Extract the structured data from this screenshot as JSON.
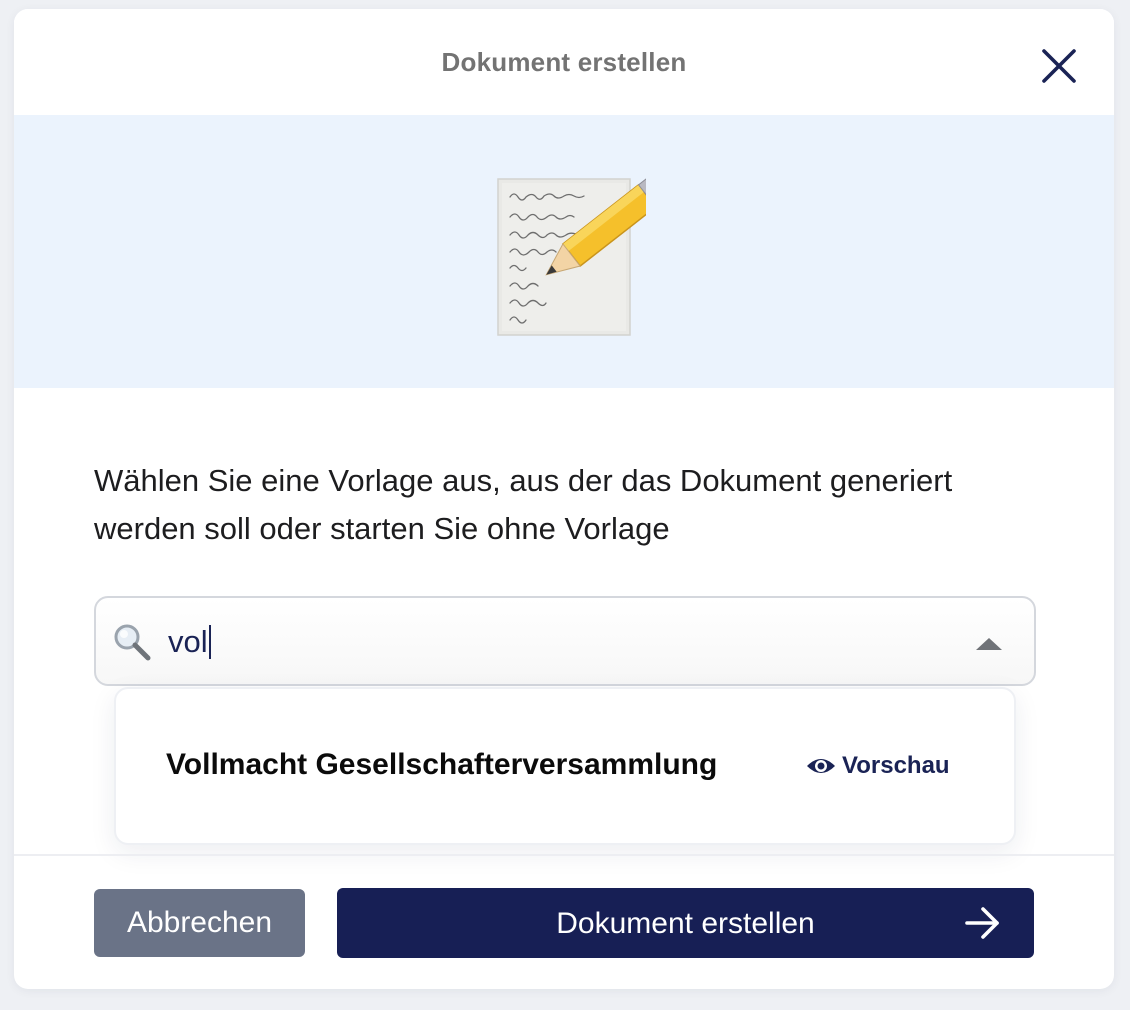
{
  "dialog": {
    "title": "Dokument erstellen",
    "close_icon": "close-icon"
  },
  "hero": {
    "icon": "memo-pencil-icon"
  },
  "instructions": "Wählen Sie eine Vorlage aus, aus der das Dokument generiert werden soll oder starten Sie ohne Vorlage",
  "search": {
    "value": "vol",
    "icon": "search-icon",
    "toggle_icon": "chevron-up-icon"
  },
  "dropdown": {
    "options": [
      {
        "label": "Vollmacht Gesellschafterversammlung",
        "preview_label": "Vorschau",
        "preview_icon": "eye-icon"
      }
    ]
  },
  "footer": {
    "cancel_label": "Abbrechen",
    "create_label": "Dokument erstellen",
    "create_icon": "arrow-right-icon"
  },
  "colors": {
    "primary": "#171f55",
    "secondary_button": "#6a7387",
    "hero_background": "#ebf3fd",
    "title_text": "#737373",
    "accent_text": "#1a2355"
  }
}
